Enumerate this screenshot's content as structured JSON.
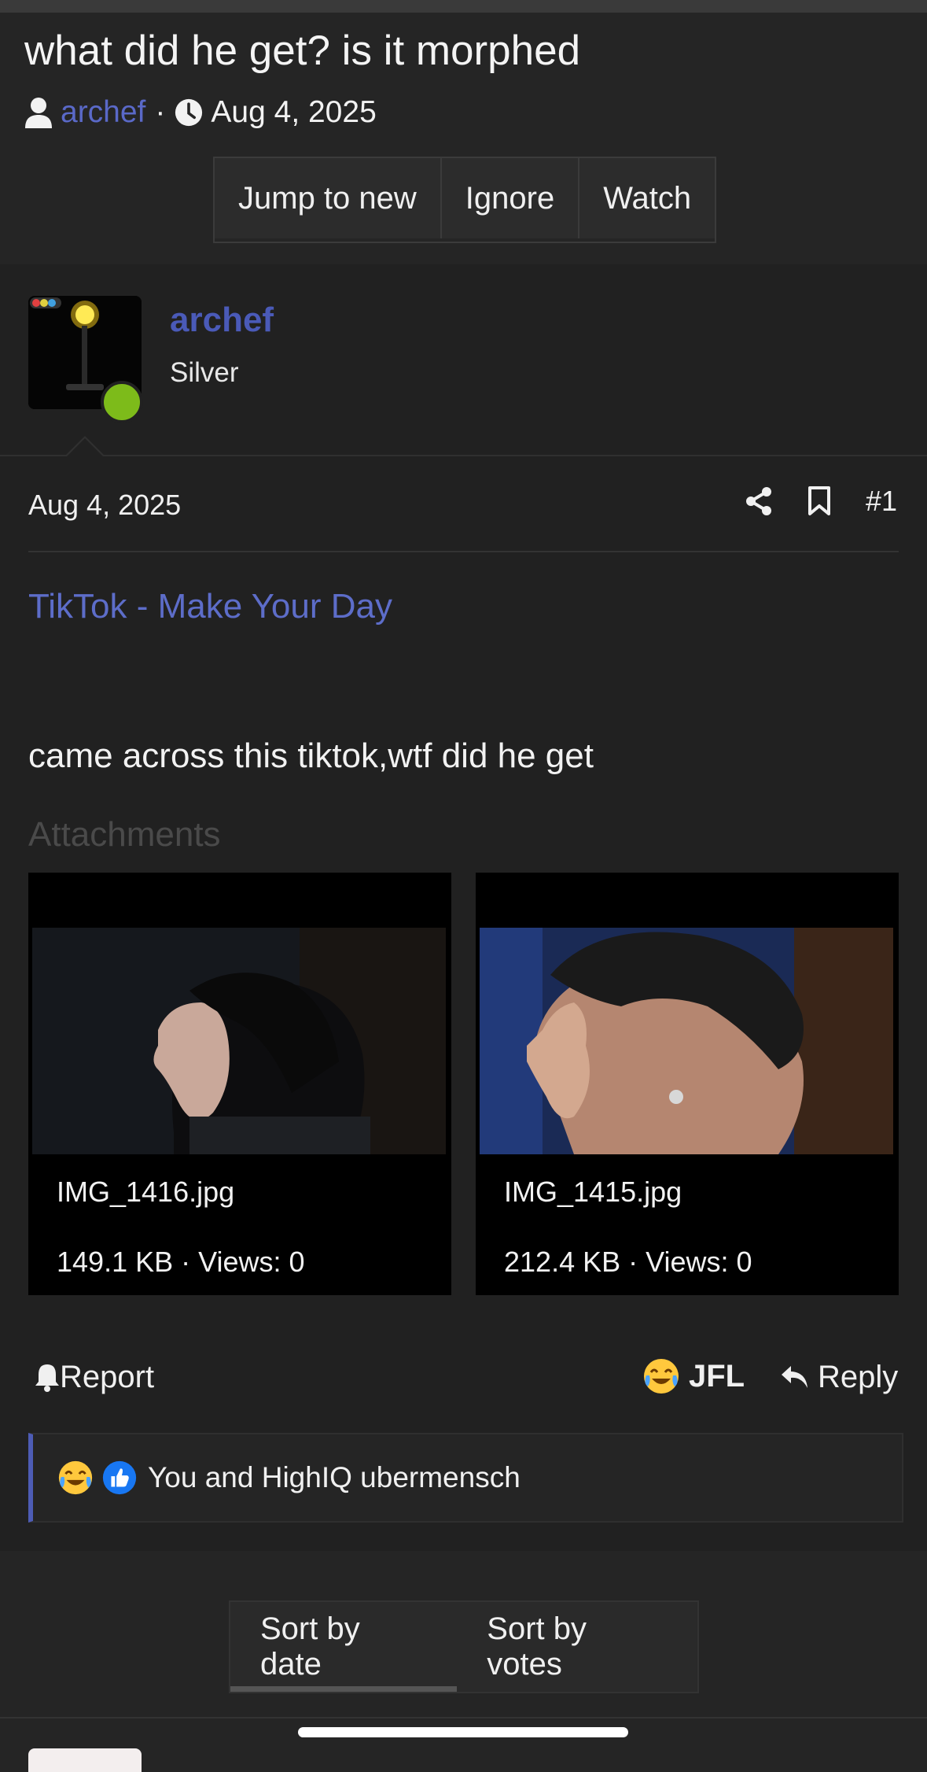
{
  "thread": {
    "title": "what did he get? is it morphed",
    "author": "archef",
    "separator": "·",
    "date": "Aug 4, 2025",
    "buttons": [
      "Jump to new",
      "Ignore",
      "Watch"
    ]
  },
  "post": {
    "username": "archef",
    "rank": "Silver",
    "date": "Aug 4, 2025",
    "number": "#1",
    "link_text": "TikTok - Make Your Day",
    "body": "came across this tiktok,wtf did he get",
    "attachments_label": "Attachments",
    "attachments": [
      {
        "name": "IMG_1416.jpg",
        "info": "149.1 KB · Views: 0"
      },
      {
        "name": "IMG_1415.jpg",
        "info": "212.4 KB · Views: 0"
      }
    ],
    "report_label": "Report",
    "reaction_label": "JFL",
    "reply_label": "Reply",
    "reactions_text": "You and HighIQ ubermensch"
  },
  "sort": {
    "options": [
      "Sort by date",
      "Sort by votes"
    ]
  },
  "colors": {
    "accent": "#5a69c8",
    "online": "#7dbb1a",
    "background": "#212121"
  }
}
